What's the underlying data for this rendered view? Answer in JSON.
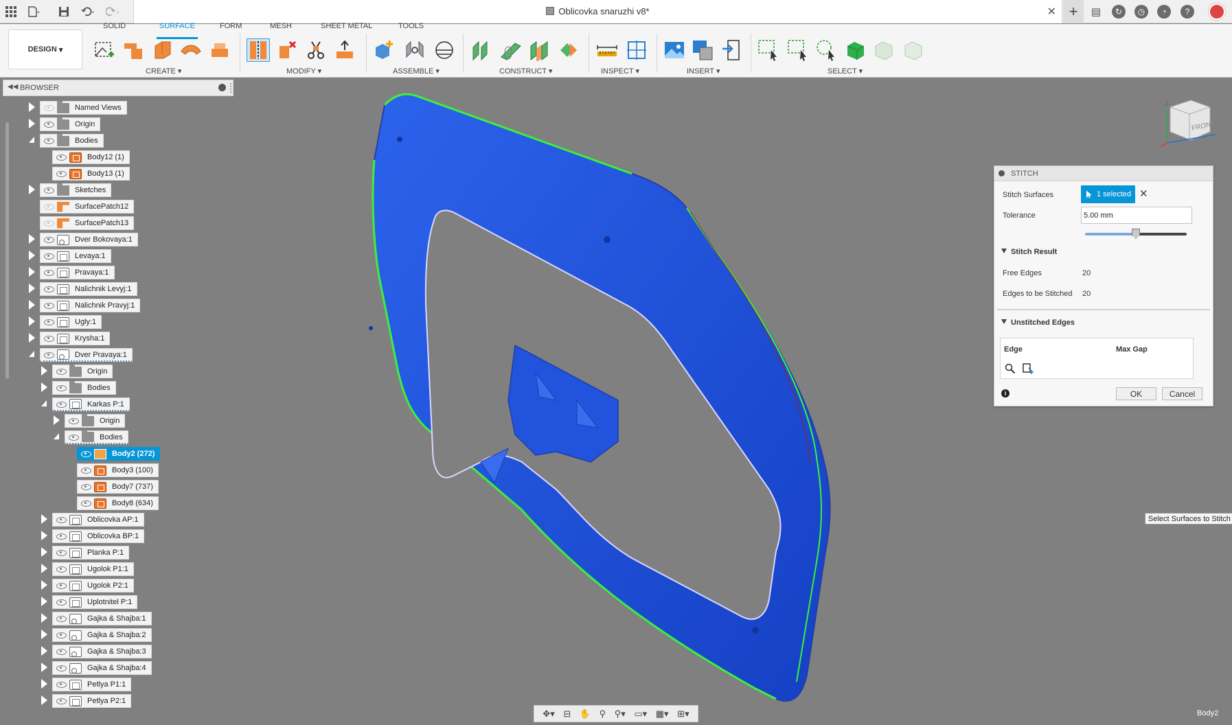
{
  "app": {
    "document_title": "Oblicovka snaruzhi v8*"
  },
  "toolbar": {
    "design_label": "DESIGN",
    "workspace_tabs": [
      "SOLID",
      "SURFACE",
      "FORM",
      "MESH",
      "SHEET METAL",
      "TOOLS"
    ],
    "active_tab": "SURFACE",
    "groups": [
      "CREATE",
      "MODIFY",
      "ASSEMBLE",
      "CONSTRUCT",
      "INSPECT",
      "INSERT",
      "SELECT"
    ]
  },
  "browser": {
    "title": "BROWSER",
    "nodes": [
      {
        "label": "Named Views",
        "depth": 0,
        "arrow": "closed",
        "icon": "folder",
        "eye": false
      },
      {
        "label": "Origin",
        "depth": 0,
        "arrow": "closed",
        "icon": "folder",
        "eye": true
      },
      {
        "label": "Bodies",
        "depth": 0,
        "arrow": "open",
        "icon": "folder",
        "eye": true
      },
      {
        "label": "Body12 (1)",
        "depth": 1,
        "arrow": "none",
        "icon": "body",
        "eye": true
      },
      {
        "label": "Body13 (1)",
        "depth": 1,
        "arrow": "none",
        "icon": "body",
        "eye": true
      },
      {
        "label": "Sketches",
        "depth": 0,
        "arrow": "closed",
        "icon": "folder",
        "eye": true
      },
      {
        "label": "SurfacePatch12",
        "depth": 0,
        "arrow": "none",
        "icon": "patch",
        "eye": false
      },
      {
        "label": "SurfacePatch13",
        "depth": 0,
        "arrow": "none",
        "icon": "patch",
        "eye": false
      },
      {
        "label": "Dver Bokovaya:1",
        "depth": 0,
        "arrow": "closed",
        "icon": "link",
        "eye": true
      },
      {
        "label": "Levaya:1",
        "depth": 0,
        "arrow": "closed",
        "icon": "comp",
        "eye": true
      },
      {
        "label": "Pravaya:1",
        "depth": 0,
        "arrow": "closed",
        "icon": "comp",
        "eye": true
      },
      {
        "label": "Nalichnik Levyj:1",
        "depth": 0,
        "arrow": "closed",
        "icon": "comp",
        "eye": true
      },
      {
        "label": "Nalichnik Pravyj:1",
        "depth": 0,
        "arrow": "closed",
        "icon": "comp",
        "eye": true
      },
      {
        "label": "Ugly:1",
        "depth": 0,
        "arrow": "closed",
        "icon": "comp",
        "eye": true
      },
      {
        "label": "Krysha:1",
        "depth": 0,
        "arrow": "closed",
        "icon": "comp",
        "eye": true
      },
      {
        "label": "Dver Pravaya:1",
        "depth": 0,
        "arrow": "open",
        "icon": "link",
        "eye": true,
        "dashed": true
      },
      {
        "label": "Origin",
        "depth": 1,
        "arrow": "closed",
        "icon": "folder",
        "eye": true
      },
      {
        "label": "Bodies",
        "depth": 1,
        "arrow": "closed",
        "icon": "folder",
        "eye": true
      },
      {
        "label": "Karkas P:1",
        "depth": 1,
        "arrow": "open",
        "icon": "comp",
        "eye": true,
        "dashed": true
      },
      {
        "label": "Origin",
        "depth": 2,
        "arrow": "closed",
        "icon": "folder",
        "eye": true
      },
      {
        "label": "Bodies",
        "depth": 2,
        "arrow": "open",
        "icon": "folder",
        "eye": true,
        "dashed": true
      },
      {
        "label": "Body2 (272)",
        "depth": 3,
        "arrow": "none",
        "icon": "sel-body",
        "eye": true,
        "selected": true
      },
      {
        "label": "Body3 (100)",
        "depth": 3,
        "arrow": "none",
        "icon": "body",
        "eye": true
      },
      {
        "label": "Body7 (737)",
        "depth": 3,
        "arrow": "none",
        "icon": "body",
        "eye": true
      },
      {
        "label": "Body8 (634)",
        "depth": 3,
        "arrow": "none",
        "icon": "body",
        "eye": true
      },
      {
        "label": "Oblicovka AP:1",
        "depth": 1,
        "arrow": "closed",
        "icon": "comp",
        "eye": true
      },
      {
        "label": "Oblicovka BP:1",
        "depth": 1,
        "arrow": "closed",
        "icon": "comp",
        "eye": true
      },
      {
        "label": "Planka P:1",
        "depth": 1,
        "arrow": "closed",
        "icon": "comp",
        "eye": true
      },
      {
        "label": "Ugolok P1:1",
        "depth": 1,
        "arrow": "closed",
        "icon": "comp",
        "eye": true
      },
      {
        "label": "Ugolok P2:1",
        "depth": 1,
        "arrow": "closed",
        "icon": "comp",
        "eye": true
      },
      {
        "label": "Uplotnitel P:1",
        "depth": 1,
        "arrow": "closed",
        "icon": "comp",
        "eye": true
      },
      {
        "label": "Gajka & Shajba:1",
        "depth": 1,
        "arrow": "closed",
        "icon": "link",
        "eye": true
      },
      {
        "label": "Gajka & Shajba:2",
        "depth": 1,
        "arrow": "closed",
        "icon": "link",
        "eye": true
      },
      {
        "label": "Gajka & Shajba:3",
        "depth": 1,
        "arrow": "closed",
        "icon": "link",
        "eye": true
      },
      {
        "label": "Gajka & Shajba:4",
        "depth": 1,
        "arrow": "closed",
        "icon": "link",
        "eye": true
      },
      {
        "label": "Petlya P1:1",
        "depth": 1,
        "arrow": "closed",
        "icon": "comp",
        "eye": true
      },
      {
        "label": "Petlya P2:1",
        "depth": 1,
        "arrow": "closed",
        "icon": "comp",
        "eye": true
      }
    ]
  },
  "viewcube": {
    "face_label": "FRONT",
    "axis_label": "Z"
  },
  "stitch": {
    "title": "STITCH",
    "stitch_surfaces_label": "Stitch Surfaces",
    "selection_value": "1 selected",
    "tolerance_label": "Tolerance",
    "tolerance_value": "5.00 mm",
    "tolerance_slider_fraction": 0.49,
    "result_section": "Stitch Result",
    "free_edges_label": "Free Edges",
    "free_edges_value": "20",
    "edges_to_stitch_label": "Edges to be Stitched",
    "edges_to_stitch_value": "20",
    "unstitched_section": "Unstitched Edges",
    "col_edge": "Edge",
    "col_max_gap": "Max Gap",
    "ok_label": "OK",
    "cancel_label": "Cancel"
  },
  "hint_text": "Select Surfaces to Stitch",
  "status_selection": "Body2",
  "colors": {
    "accent": "#0696d7",
    "model_body": "#1a57e0",
    "model_highlight": "#3cf03c",
    "viewport_bg": "#808080"
  }
}
